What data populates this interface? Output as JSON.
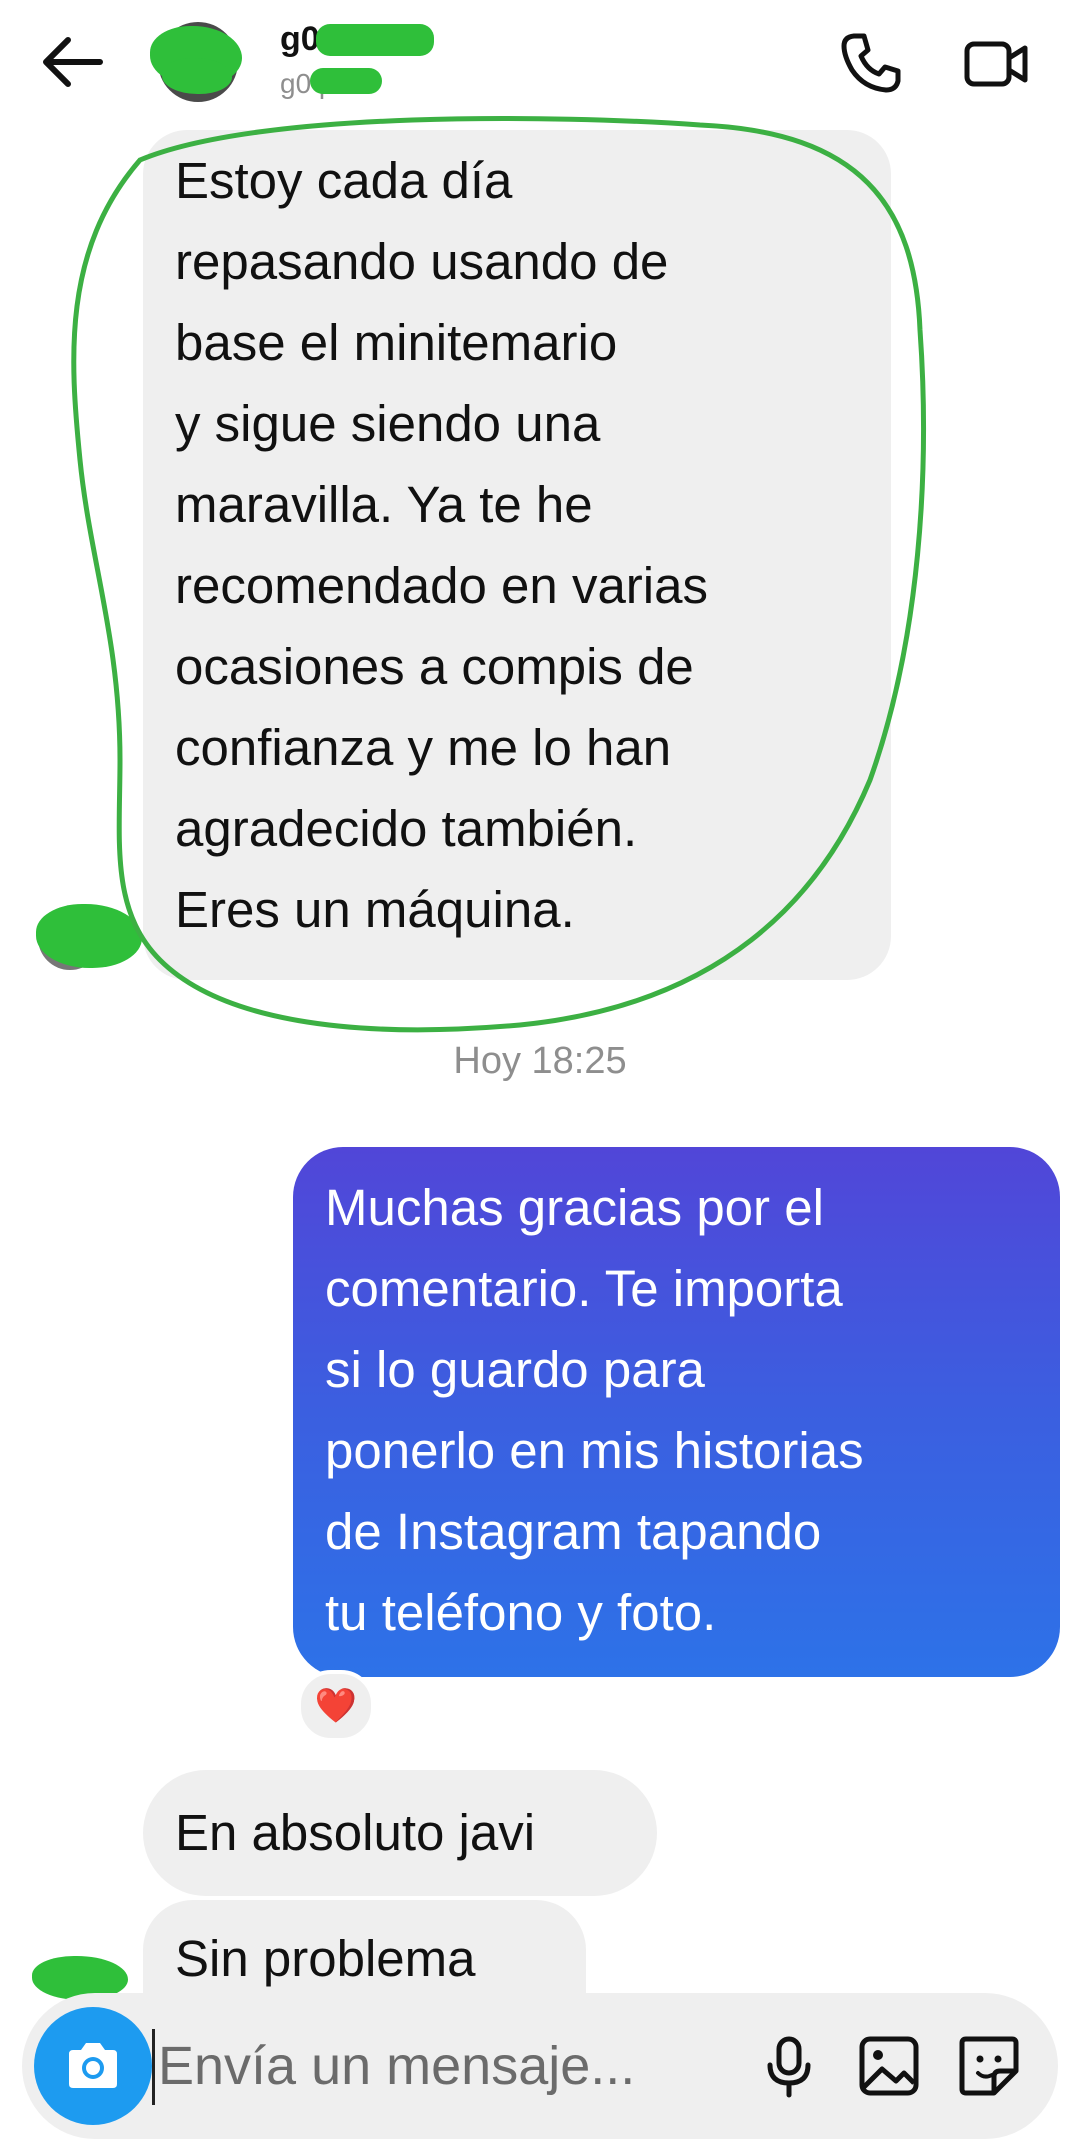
{
  "header": {
    "contact_name": "g0",
    "contact_username": "g0   p",
    "icons": {
      "back": "back-arrow-icon",
      "call": "phone-icon",
      "video": "video-camera-icon"
    }
  },
  "conversation": {
    "message_1": {
      "direction": "incoming",
      "lines": [
        "Estoy cada día",
        "repasando usando de",
        "base el minitemario",
        "y sigue siendo una",
        "maravilla. Ya te he",
        "recomendado en varias",
        "ocasiones a compis de",
        "confianza y me lo han",
        "agradecido también.",
        "Eres un máquina."
      ]
    },
    "timestamp": "Hoy 18:25",
    "message_2": {
      "direction": "outgoing",
      "lines": [
        "Muchas gracias por el",
        "comentario. Te importa",
        "si lo guardo para",
        "ponerlo en mis historias",
        "de Instagram tapando",
        "tu teléfono y foto."
      ],
      "reaction": "❤️"
    },
    "message_3": {
      "direction": "incoming",
      "text": "En absoluto javi"
    },
    "message_4": {
      "direction": "incoming",
      "text": "Sin problema"
    }
  },
  "composer": {
    "placeholder": "Envía un mensaje...",
    "icons": {
      "camera": "camera-icon",
      "mic": "microphone-icon",
      "gallery": "image-icon",
      "sticker": "sticker-icon"
    }
  },
  "colors": {
    "incoming_bubble": "#efefef",
    "outgoing_gradient_top": "#5146d8",
    "outgoing_gradient_bottom": "#2d72e8",
    "camera_button": "#1d9bf0",
    "redaction": "#2fbf3a",
    "highlight": "#3cb043"
  }
}
